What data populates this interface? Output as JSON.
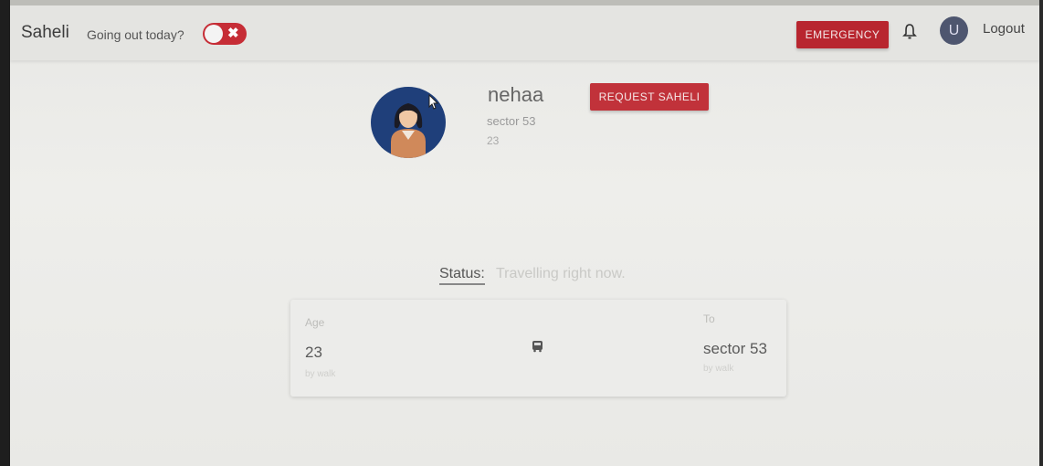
{
  "navbar": {
    "brand": "Saheli",
    "going_out_label": "Going out today?",
    "toggle_state": "off",
    "emergency_label": "EMERGENCY",
    "avatar_initial": "U",
    "logout_label": "Logout"
  },
  "profile": {
    "name": "nehaa",
    "address": "sector 53",
    "age": "23",
    "request_label": "REQUEST SAHELI"
  },
  "status": {
    "label": "Status:",
    "text": "Travelling right now."
  },
  "trip_card": {
    "left": {
      "label": "Age",
      "value": "23",
      "sub": "by walk"
    },
    "right": {
      "label": "To",
      "value": "sector 53",
      "sub": "by walk"
    }
  },
  "colors": {
    "accent_red": "#c1323a",
    "avatar_bg": "#4e566f"
  }
}
